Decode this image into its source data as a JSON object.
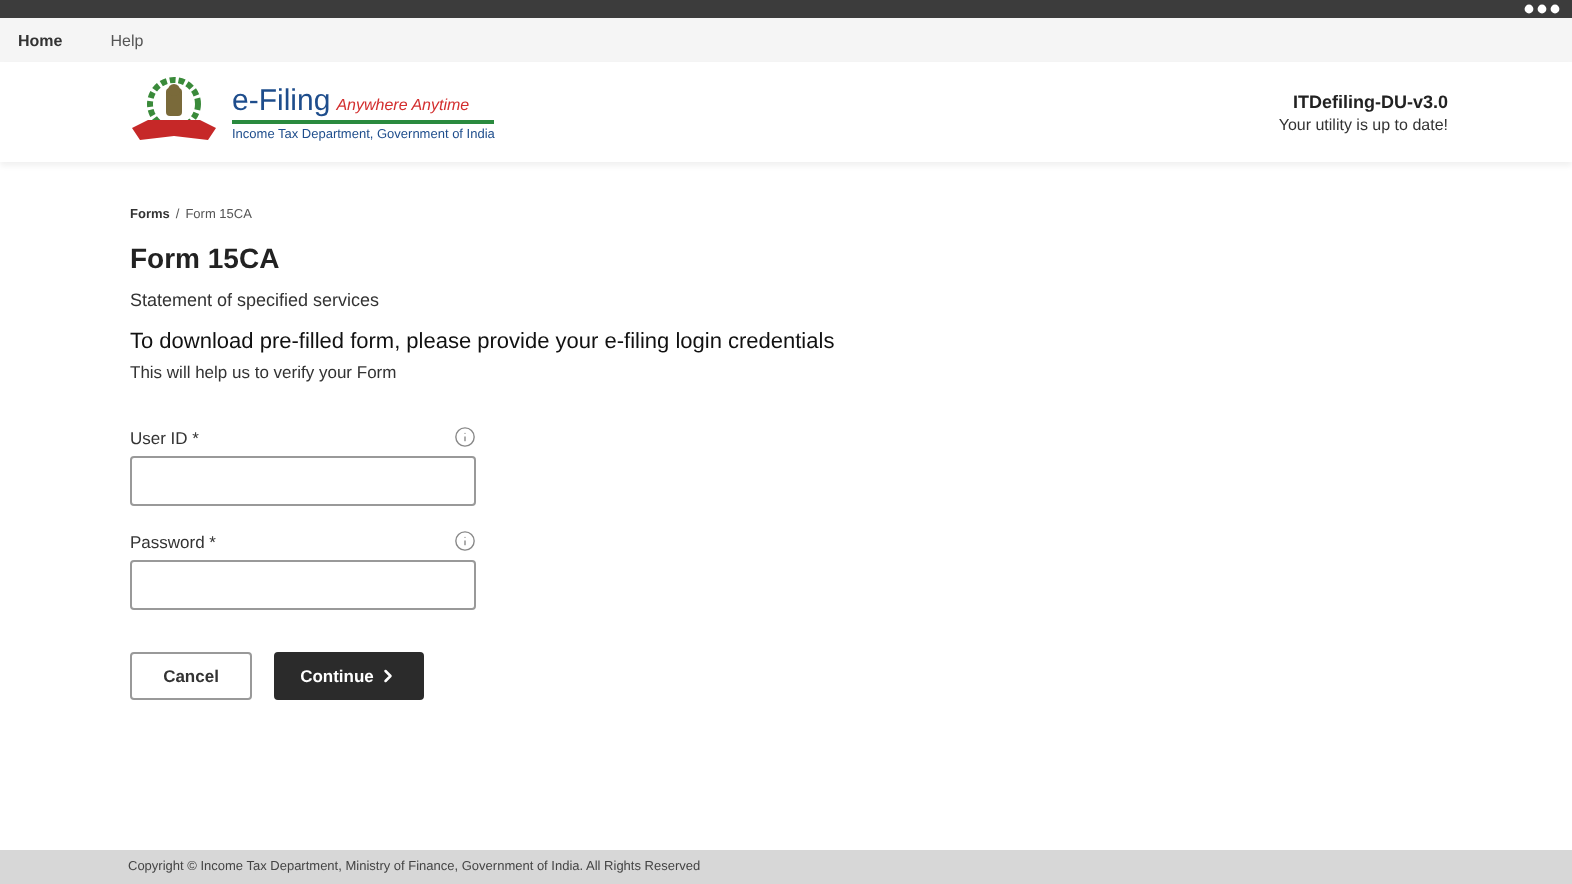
{
  "menu": [
    {
      "label": "Home",
      "selected": true
    },
    {
      "label": "Help",
      "selected": false
    }
  ],
  "header": {
    "logo_title": "e-Filing",
    "logo_tagline": "Anywhere Anytime",
    "logo_subtitle": "Income Tax Department, Government of India",
    "app_name": "ITDefiling-DU-v3.0",
    "app_status": "Your utility is up to date!"
  },
  "breadcrumb": [
    {
      "label": "Forms",
      "current": false
    },
    {
      "label": "Form 15CA",
      "current": true
    }
  ],
  "breadcrumb_separator": "/",
  "title": "Form 15CA",
  "subtitle": "Statement of specified services",
  "prompt": "To download pre-filled form, please provide your e-filing login credentials",
  "prompt_note": "This will help us to verify your Form",
  "fields": [
    {
      "label": "User ID *"
    },
    {
      "label": "Password *"
    }
  ],
  "buttons": [
    {
      "label": "Cancel",
      "kind": "secondary"
    },
    {
      "label": "Continue",
      "kind": "primary"
    }
  ],
  "footer": "Copyright © Income Tax Department, Ministry of Finance, Government of India. All Rights Reserved"
}
